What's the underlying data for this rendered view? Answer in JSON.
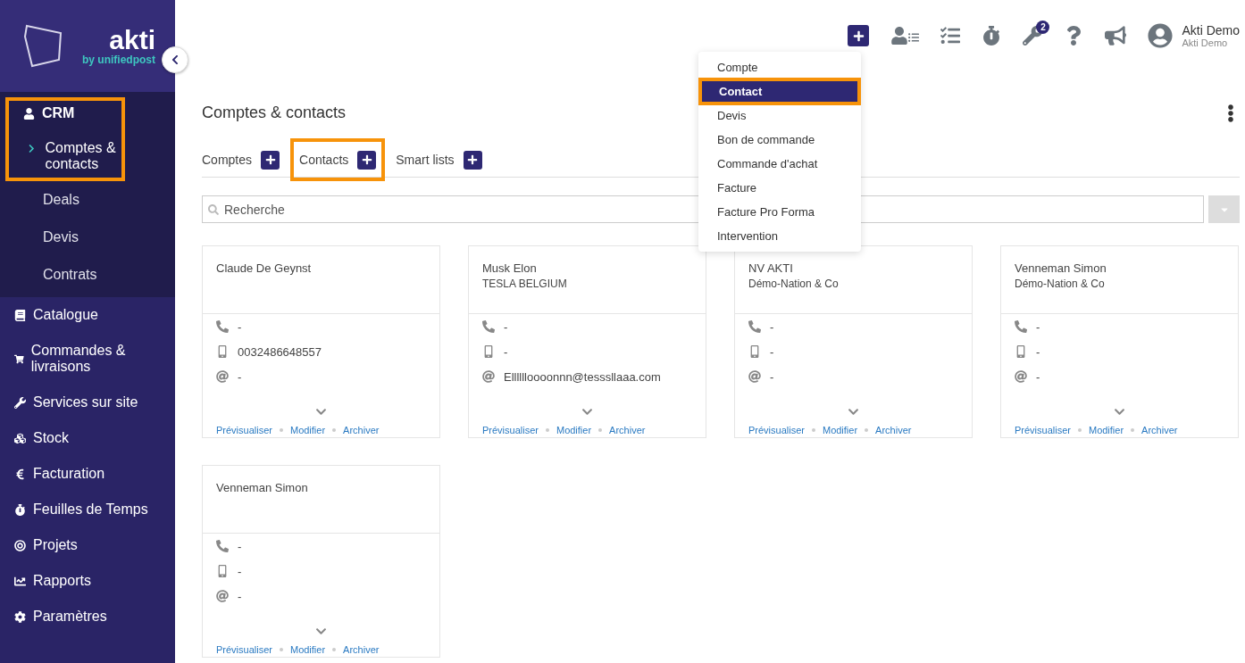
{
  "logo": {
    "name": "akti",
    "tagline": "by unifiedpost"
  },
  "sidebar": {
    "groups": [
      {
        "label": "CRM",
        "expanded": true,
        "highlighted": true,
        "children": [
          {
            "label": "Comptes & contacts",
            "selected": true
          },
          {
            "label": "Deals",
            "selected": false
          },
          {
            "label": "Devis",
            "selected": false
          },
          {
            "label": "Contrats",
            "selected": false
          }
        ]
      },
      {
        "label": "Catalogue",
        "expanded": false
      },
      {
        "label": "Commandes & livraisons",
        "expanded": false
      },
      {
        "label": "Services sur site",
        "expanded": false
      },
      {
        "label": "Stock",
        "expanded": false
      },
      {
        "label": "Facturation",
        "expanded": false
      },
      {
        "label": "Feuilles de Temps",
        "expanded": false
      },
      {
        "label": "Projets",
        "expanded": false
      },
      {
        "label": "Rapports",
        "expanded": false
      },
      {
        "label": "Paramètres",
        "expanded": false
      }
    ]
  },
  "topbar": {
    "badge": "2",
    "user": {
      "name": "Akti Demo",
      "company": "Akti Demo"
    }
  },
  "add_menu": {
    "items": [
      {
        "label": "Compte",
        "selected": false,
        "highlighted": false
      },
      {
        "label": "Contact",
        "selected": true,
        "highlighted": true
      },
      {
        "label": "Devis",
        "selected": false,
        "highlighted": false
      },
      {
        "label": "Bon de commande",
        "selected": false,
        "highlighted": false
      },
      {
        "label": "Commande d'achat",
        "selected": false,
        "highlighted": false
      },
      {
        "label": "Facture",
        "selected": false,
        "highlighted": false
      },
      {
        "label": "Facture Pro Forma",
        "selected": false,
        "highlighted": false
      },
      {
        "label": "Intervention",
        "selected": false,
        "highlighted": false
      }
    ]
  },
  "page": {
    "title": "Comptes & contacts"
  },
  "tabs": [
    {
      "label": "Comptes",
      "highlighted": false
    },
    {
      "label": "Contacts",
      "highlighted": true
    },
    {
      "label": "Smart lists",
      "highlighted": false
    }
  ],
  "search": {
    "placeholder": "Recherche"
  },
  "cards": [
    {
      "name": "Claude De Geynst",
      "fields": [
        {
          "kind": "phone",
          "value": "-"
        },
        {
          "kind": "mobile",
          "value": "0032486648557"
        },
        {
          "kind": "email",
          "value": "-"
        }
      ],
      "actions": [
        "Prévisualiser",
        "Modifier",
        "Archiver"
      ]
    },
    {
      "name": "Musk Elon",
      "company": "TESLA BELGIUM",
      "fields": [
        {
          "kind": "phone",
          "value": "-"
        },
        {
          "kind": "mobile",
          "value": "-"
        },
        {
          "kind": "email",
          "value": "Elllllloooonnn@tesssllaaa.com"
        }
      ],
      "actions": [
        "Prévisualiser",
        "Modifier",
        "Archiver"
      ]
    },
    {
      "name": "NV AKTI",
      "company": "Démo-Nation & Co",
      "fields": [
        {
          "kind": "phone",
          "value": "-"
        },
        {
          "kind": "mobile",
          "value": "-"
        },
        {
          "kind": "email",
          "value": "-"
        }
      ],
      "actions": [
        "Prévisualiser",
        "Modifier",
        "Archiver"
      ]
    },
    {
      "name": "Venneman Simon",
      "company": "Démo-Nation & Co",
      "fields": [
        {
          "kind": "phone",
          "value": "-"
        },
        {
          "kind": "mobile",
          "value": "-"
        },
        {
          "kind": "email",
          "value": "-"
        }
      ],
      "actions": [
        "Prévisualiser",
        "Modifier",
        "Archiver"
      ]
    },
    {
      "name": "Venneman Simon",
      "fields": [
        {
          "kind": "phone",
          "value": "-"
        },
        {
          "kind": "mobile",
          "value": "-"
        },
        {
          "kind": "email",
          "value": "-"
        }
      ],
      "actions": [
        "Prévisualiser",
        "Modifier",
        "Archiver"
      ]
    }
  ]
}
